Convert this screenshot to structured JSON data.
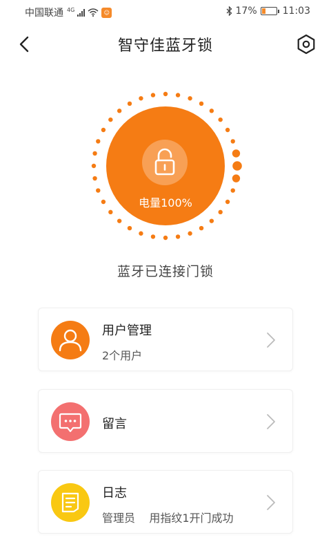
{
  "status_bar": {
    "carrier": "中国联通",
    "network": "4G",
    "battery_percent": "17%",
    "time": "11:03",
    "icons": [
      "signal-icon",
      "wifi-icon",
      "app-notification-icon",
      "bluetooth-icon",
      "battery-icon"
    ]
  },
  "header": {
    "title": "智守佳蓝牙锁",
    "back_icon": "chevron-left-icon",
    "settings_icon": "hexagon-settings-icon"
  },
  "lock": {
    "battery_label": "电量100%",
    "icon": "unlocked-padlock-icon",
    "accent_color": "#f57c14"
  },
  "connection_status": "蓝牙已连接门锁",
  "menu": [
    {
      "title": "用户管理",
      "subtitle": "2个用户",
      "icon": "user-icon",
      "icon_color": "#f57c14"
    },
    {
      "title": "留言",
      "subtitle": "",
      "icon": "message-icon",
      "icon_color": "#f37070"
    },
    {
      "title": "日志",
      "subtitle": "管理员    用指纹1开门成功",
      "icon": "log-document-icon",
      "icon_color": "#f9c812"
    }
  ]
}
